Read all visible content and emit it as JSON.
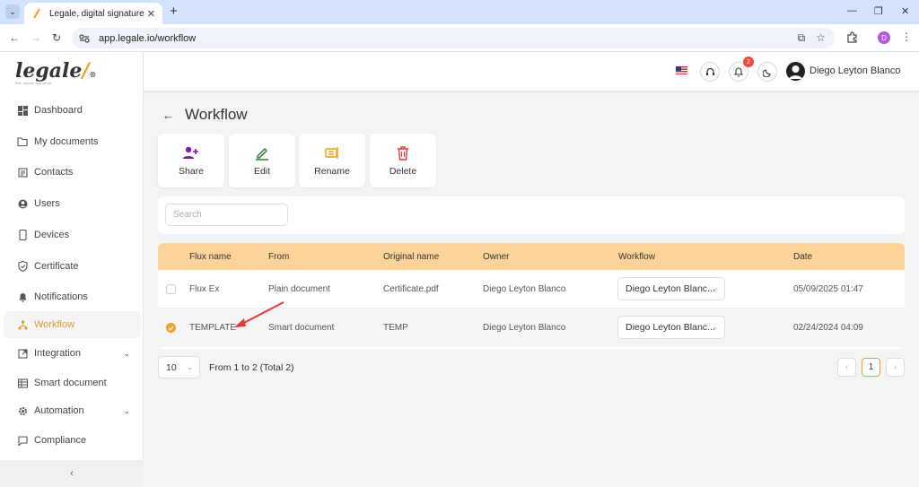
{
  "browser": {
    "tab_title": "Legale, digital signature",
    "url": "app.legale.io/workflow",
    "profile_initial": "D"
  },
  "brand": {
    "name": "legale",
    "tagline": "free, secure and smart",
    "accent": "#f39c12"
  },
  "sidebar": {
    "items": [
      {
        "label": "Dashboard",
        "icon": "dashboard-icon"
      },
      {
        "label": "My documents",
        "icon": "folder-icon"
      },
      {
        "label": "Contacts",
        "icon": "contacts-icon"
      },
      {
        "label": "Users",
        "icon": "user-icon"
      },
      {
        "label": "Devices",
        "icon": "device-icon"
      },
      {
        "label": "Certificate",
        "icon": "shield-icon"
      },
      {
        "label": "Notifications",
        "icon": "bell-icon"
      },
      {
        "label": "Workflow",
        "icon": "workflow-icon"
      },
      {
        "label": "Integration",
        "icon": "integration-icon"
      },
      {
        "label": "Smart document",
        "icon": "smart-document-icon"
      },
      {
        "label": "Automation",
        "icon": "gear-icon"
      },
      {
        "label": "Compliance",
        "icon": "chat-icon"
      }
    ],
    "active_item": "Workflow",
    "collapse_label": "‹"
  },
  "header": {
    "notification_count": "2",
    "user_name": "Diego Leyton Blanco"
  },
  "page": {
    "title": "Workflow"
  },
  "actions": [
    {
      "label": "Share",
      "icon": "share-user-icon",
      "color": "#7b1fa2"
    },
    {
      "label": "Edit",
      "icon": "edit-icon",
      "color": "#2e7d32"
    },
    {
      "label": "Rename",
      "icon": "rename-icon",
      "color": "#f39c12"
    },
    {
      "label": "Delete",
      "icon": "trash-icon",
      "color": "#e53935"
    }
  ],
  "search": {
    "placeholder": "Search"
  },
  "table": {
    "columns": [
      "Flux name",
      "From",
      "Original name",
      "Owner",
      "Workflow",
      "Date"
    ],
    "rows": [
      {
        "flux_name": "Flux Ex",
        "from": "Plain document",
        "original_name": "Certificate.pdf",
        "owner": "Diego Leyton Blanco",
        "workflow": "Diego Leyton Blanc...",
        "date": "05/09/2025 01:47",
        "selected": false
      },
      {
        "flux_name": "TEMPLATE",
        "from": "Smart document",
        "original_name": "TEMP",
        "owner": "Diego Leyton Blanco",
        "workflow": "Diego Leyton Blanc...",
        "date": "02/24/2024 04:09",
        "selected": true
      }
    ]
  },
  "pagination": {
    "page_size": "10",
    "range_text": "From 1 to 2 (Total 2)",
    "prev": "‹",
    "current_page": "1",
    "next": "›"
  }
}
